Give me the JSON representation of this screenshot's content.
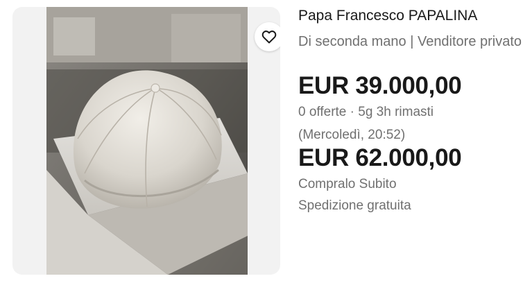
{
  "listing": {
    "title": "Papa Francesco PAPALINA",
    "condition": "Di seconda mano | Venditore privato",
    "price": "EUR 39.000,00",
    "bids": "0 offerte · 5g 3h rimasti",
    "end_time": "(Mercoledì, 20:52)",
    "buy_now_price": "EUR 62.000,00",
    "buy_now_label": "Compralo Subito",
    "shipping": "Spedizione gratuita"
  },
  "icons": {
    "watch": "heart-icon"
  },
  "colors": {
    "text_primary": "#191919",
    "text_secondary": "#707070",
    "card_bg": "#f2f2f2"
  }
}
